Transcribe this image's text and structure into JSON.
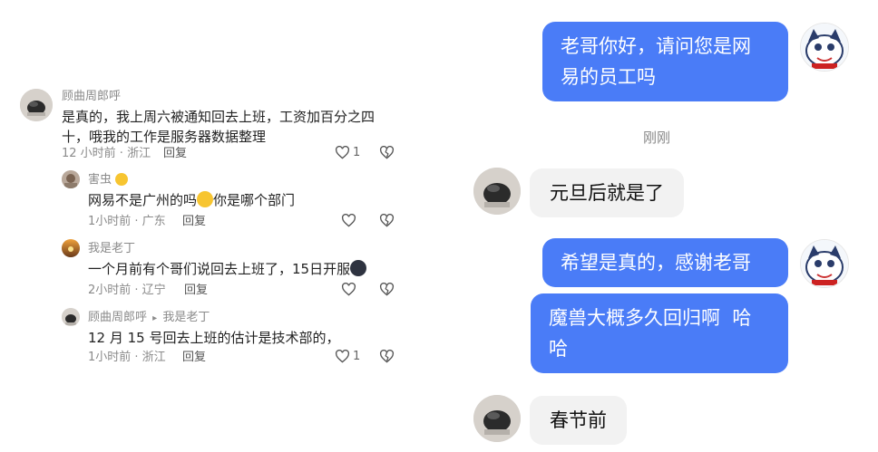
{
  "comments": [
    {
      "author": "顾曲周郎呼",
      "text_line1": "是真的，我上周六被通知回去上班，工资加百分之四",
      "text_line2": "十，哦我的工作是服务器数据整理",
      "time_location": "12 小时前 · 浙江",
      "reply_label": "回复",
      "like_count": "1"
    },
    {
      "author": "害虫",
      "author_emoji": "smile-emoji-icon",
      "text": "网易不是广州的吗",
      "text_emoji": "sweat-laugh-emoji-icon",
      "text_after": "你是哪个部门",
      "time_location": "1小时前 · 广东",
      "reply_label": "回复"
    },
    {
      "author": "我是老丁",
      "text": "一个月前有个哥们说回去上班了，15日开服",
      "text_emoji": "face-emoji-icon",
      "time_location": "2小时前 · 辽宁",
      "reply_label": "回复"
    },
    {
      "author": "顾曲周郎呼",
      "reply_arrow": "▸",
      "reply_to": "我是老丁",
      "text": "12 月 15 号回去上班的估计是技术部的，",
      "time_location": "1小时前 · 浙江",
      "reply_label": "回复",
      "like_count": "1"
    }
  ],
  "chat": {
    "messages": [
      {
        "side": "out",
        "line1": "老哥你好，请问您是网",
        "line2": "易的员工吗"
      },
      {
        "side": "in",
        "text": "元旦后就是了"
      },
      {
        "side": "out",
        "text": "希望是真的，感谢老哥"
      },
      {
        "side": "out",
        "line1": "魔兽大概多久回归啊  哈",
        "line2": "哈"
      },
      {
        "side": "in",
        "text": "春节前"
      }
    ],
    "time_divider": "刚刚"
  },
  "colors": {
    "bubble_out": "#4a7cf7",
    "bubble_in": "#f2f2f2",
    "meta_gray": "#8a8a8a"
  }
}
